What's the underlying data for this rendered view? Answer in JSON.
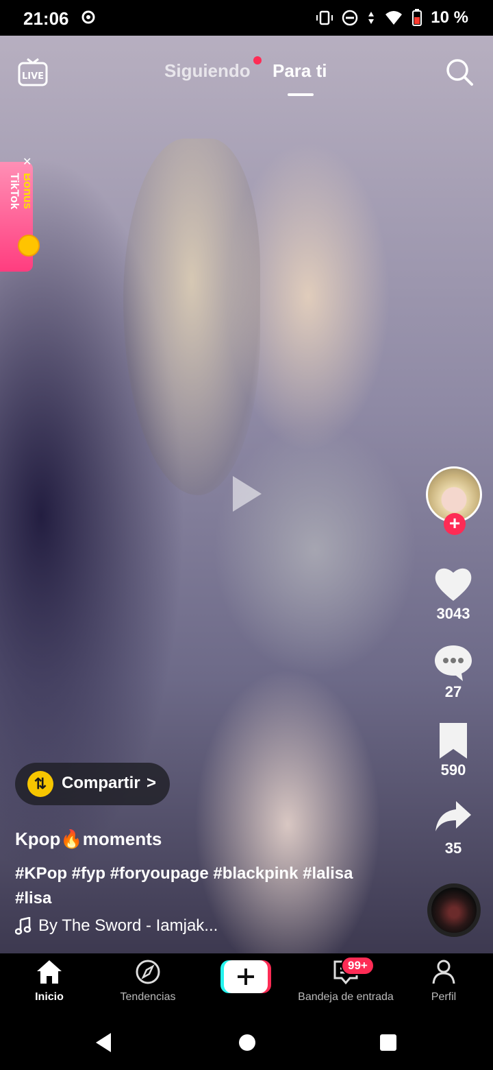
{
  "status_bar": {
    "time": "21:06",
    "battery_text": "10 %",
    "icons": [
      "notification-icon",
      "vibrate-icon",
      "do-not-disturb-icon",
      "data-arrows-icon",
      "wifi-icon",
      "battery-low-icon"
    ]
  },
  "top_bar": {
    "live_label": "LIVE",
    "tabs": [
      {
        "label": "Siguiendo",
        "active": false,
        "has_dot": true
      },
      {
        "label": "Para ti",
        "active": true
      }
    ]
  },
  "bonus_badge": {
    "line1": "TikTok",
    "line2": "Bonus"
  },
  "right_rail": {
    "likes": "3043",
    "comments": "27",
    "saves": "590",
    "shares": "35"
  },
  "share_pill": {
    "label": "Compartir",
    "chevron": ">"
  },
  "post": {
    "author_prefix": "Kpop",
    "author_emoji": "🔥",
    "author_suffix": "moments",
    "caption": "#KPop #fyp #foryoupage #blackpink #lalisa #lisa",
    "music": "By The Sword - Iamjak..."
  },
  "bottom_nav": {
    "items": [
      {
        "label": "Inicio",
        "icon": "home-icon",
        "active": true
      },
      {
        "label": "Tendencias",
        "icon": "compass-icon",
        "active": false
      },
      {
        "label": "",
        "icon": "plus-icon",
        "active": false
      },
      {
        "label": "Bandeja de entrada",
        "icon": "inbox-icon",
        "active": false
      },
      {
        "label": "Perfil",
        "icon": "profile-icon",
        "active": false
      }
    ],
    "inbox_badge": "99+",
    "colors": {
      "accent_red": "#fe2c55",
      "accent_cyan": "#25f4ee"
    }
  }
}
